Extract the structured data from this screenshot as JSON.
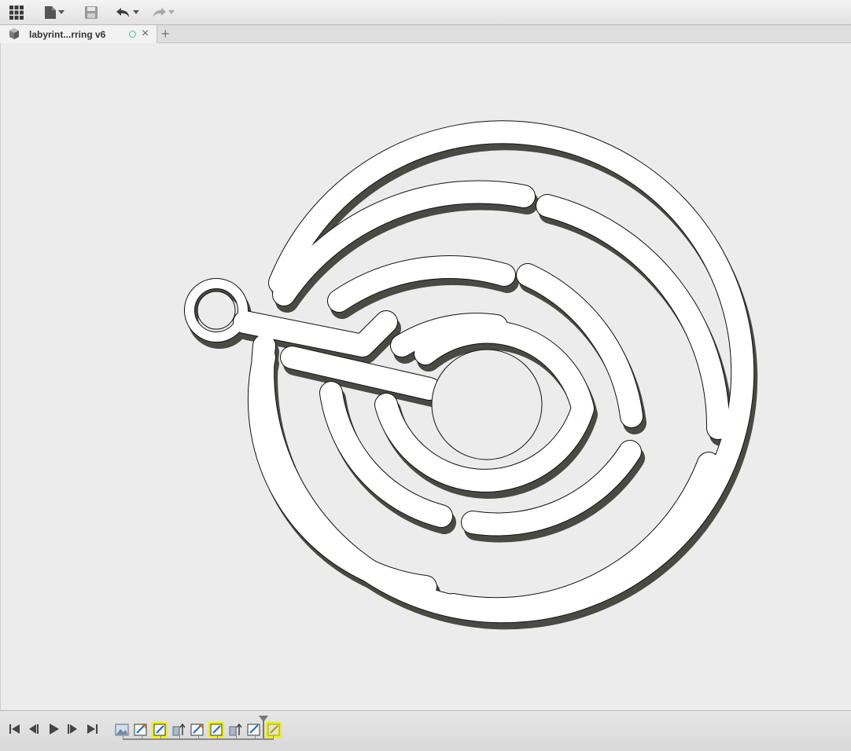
{
  "toolbar": {
    "items": [
      {
        "name": "data-panel",
        "icon": "grid-icon"
      },
      {
        "name": "file-menu",
        "icon": "document-icon"
      },
      {
        "name": "save",
        "icon": "save-icon"
      },
      {
        "name": "undo",
        "icon": "undo-icon"
      },
      {
        "name": "redo",
        "icon": "redo-icon"
      }
    ]
  },
  "tabs": [
    {
      "label": "labyrint...rring v6",
      "status": "unsaved",
      "status_color": "#4ac2a6"
    }
  ],
  "tab_add_glyph": "+",
  "tab_close_glyph": "×",
  "canvas": {
    "model": "labyrinth-earring",
    "colors": {
      "background": "#ececec",
      "body": "#ffffff",
      "wall": "#4a4a44",
      "edge": "#111111"
    }
  },
  "timeline": {
    "playback": [
      "first",
      "previous",
      "play",
      "next",
      "last"
    ],
    "features": [
      {
        "type": "sketch",
        "highlighted": false
      },
      {
        "type": "derive",
        "highlighted": false
      },
      {
        "type": "derive",
        "highlighted": true
      },
      {
        "type": "extrude",
        "highlighted": false
      },
      {
        "type": "derive",
        "highlighted": false
      },
      {
        "type": "derive",
        "highlighted": true
      },
      {
        "type": "extrude",
        "highlighted": false
      },
      {
        "type": "derive",
        "highlighted": false
      },
      {
        "type": "derive",
        "highlighted": true
      }
    ],
    "highlight_color": "#f0f000"
  }
}
